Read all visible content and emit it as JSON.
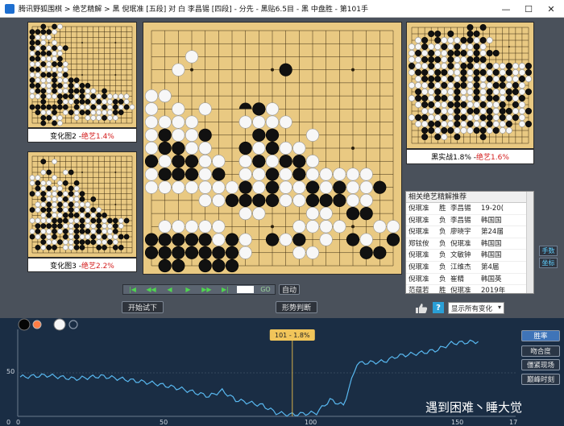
{
  "window": {
    "title": "腾讯野狐围棋 > 绝艺精解 > 黑 倪珉准 [五段] 对 白 李昌锡 [四段] - 分先 - 黑贴6.5目 - 黑 中盘胜 - 第101手",
    "minimize": "—",
    "maximize": "☐",
    "close": "✕"
  },
  "variations": {
    "var2": {
      "label": "变化图2 - ",
      "winrate": "绝艺1.4%"
    },
    "var3": {
      "label": "变化图3 - ",
      "winrate": "绝艺2.2%"
    },
    "actual": {
      "label": "黑实战1.8% - ",
      "winrate": "绝艺1.6%"
    }
  },
  "recommendations": {
    "header": "相关绝艺精解推荐",
    "rows": [
      {
        "player": "倪珉准",
        "result": "胜",
        "opponent": "李昌锡",
        "event": "19-20("
      },
      {
        "player": "倪珉准",
        "result": "负",
        "opponent": "李昌锡",
        "event": "韩国国"
      },
      {
        "player": "倪珉准",
        "result": "负",
        "opponent": "廖晓宇",
        "event": "第24届"
      },
      {
        "player": "郑铉侒",
        "result": "负",
        "opponent": "倪珉准",
        "event": "韩国国"
      },
      {
        "player": "倪珉准",
        "result": "负",
        "opponent": "文敏钟",
        "event": "韩国国"
      },
      {
        "player": "倪珉准",
        "result": "负",
        "opponent": "江维杰",
        "event": "第4届"
      },
      {
        "player": "倪珉准",
        "result": "负",
        "opponent": "崔精",
        "event": "韩国英"
      },
      {
        "player": "范蕴若",
        "result": "胜",
        "opponent": "倪珉准",
        "event": "2019年"
      }
    ]
  },
  "side_buttons": {
    "moves": "手数",
    "coords": "坐标"
  },
  "playback": {
    "first": "|◀",
    "back_fast": "◀◀",
    "back": "◀",
    "forward": "▶",
    "forward_fast": "▶▶",
    "last": "▶|",
    "go": "GO",
    "auto": "自动"
  },
  "actions": {
    "try_play": "开始试下",
    "judge": "形势判断"
  },
  "help_icon": "?",
  "display_select": {
    "value": "显示所有变化",
    "arrow": "▾"
  },
  "graph": {
    "marker_label": "101 - 1.8%",
    "y_label_mid": "50",
    "y_label_zero": "0",
    "x_ticks": [
      "0",
      "50",
      "100",
      "150"
    ],
    "x_ticks_tail": "17",
    "buttons": [
      "胜率",
      "吻合度",
      "僵紧现场",
      "巅峰时刻"
    ],
    "active_button": 0
  },
  "watermark": "遇到困难丶睡大觉",
  "colors": {
    "board": "#e9c982",
    "graph_line": "#58b8f0",
    "marker": "#f1c55a",
    "accent": "#5fd0ff"
  }
}
